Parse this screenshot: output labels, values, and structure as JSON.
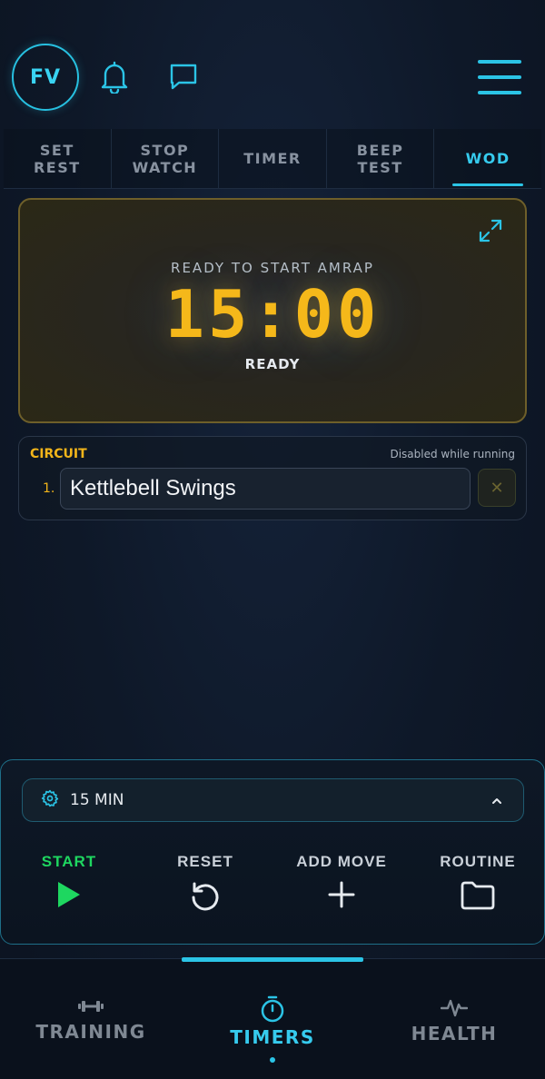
{
  "header": {
    "avatar_initials": "FV",
    "icons": [
      "bell-icon",
      "chat-icon",
      "hamburger-menu-icon"
    ]
  },
  "tabs": [
    {
      "label": "SET\nREST",
      "active": false
    },
    {
      "label": "STOP\nWATCH",
      "active": false
    },
    {
      "label": "TIMER",
      "active": false
    },
    {
      "label": "BEEP\nTEST",
      "active": false
    },
    {
      "label": "WOD",
      "active": true
    }
  ],
  "timer": {
    "subtitle": "READY TO START AMRAP",
    "time": "15:00",
    "state": "READY"
  },
  "circuit": {
    "title": "CIRCUIT",
    "note": "Disabled while running",
    "moves": [
      {
        "number": "1.",
        "name": "Kettlebell Swings"
      }
    ]
  },
  "controls": {
    "duration_label": "15 MIN",
    "actions": [
      {
        "label": "START",
        "icon": "play-icon"
      },
      {
        "label": "RESET",
        "icon": "reset-icon"
      },
      {
        "label": "ADD MOVE",
        "icon": "plus-icon"
      },
      {
        "label": "ROUTINE",
        "icon": "folder-icon"
      }
    ]
  },
  "bottom_nav": {
    "items": [
      {
        "label": "TRAINING",
        "icon": "dumbbell-icon",
        "active": false
      },
      {
        "label": "TIMERS",
        "icon": "stopwatch-icon",
        "active": true
      },
      {
        "label": "HEALTH",
        "icon": "heartbeat-icon",
        "active": false
      }
    ]
  },
  "colors": {
    "accent": "#2bc4e6",
    "timer": "#f5b81a",
    "start": "#1ed760"
  }
}
